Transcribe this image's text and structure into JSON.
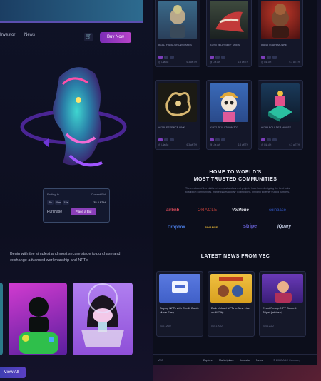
{
  "nav": {
    "items": [
      "Investor",
      "News"
    ],
    "buy_label": "Buy Now"
  },
  "hero": {
    "bid_label_left": "Ending In",
    "bid_label_right": "Current Bid",
    "times": [
      "3h",
      "20m",
      "15s"
    ],
    "price": "35.4 ETH",
    "purchase_label": "Purchase",
    "bid_button": "Place a Bid"
  },
  "tagline": "Begin with the simplest and most secure stage to purchase and exchange advanced workmanship and NFT's",
  "view_all": "View All",
  "nft_cards": [
    {
      "name": "#1347 HAND-GROWN APES",
      "tag": "#1347"
    },
    {
      "name": "#1290 JELLYBEEF DOEA",
      "tag": "#1290"
    },
    {
      "name": "#3845 (B)APEMONKE",
      "tag": "#3845"
    },
    {
      "name": "#1289 ESSENCE LINK",
      "tag": "#1289"
    },
    {
      "name": "#1932 SKULLTOON 3D3",
      "tag": "#1932"
    },
    {
      "name": "#1299 BOULDER HOUSE",
      "tag": "#1299"
    }
  ],
  "card_owner": "@ Lila Art",
  "card_price": "6.3 wETH",
  "communities": {
    "title_1": "HOME TO WORLD'S",
    "title_2": "MOST TRUSTED COMMUNITIES",
    "blurb": "The creators of this platform from past and current projects have been designing the best tools to support communities, marketplaces and NFT campaigns, bringing together trusted partners.",
    "logos": [
      {
        "name": "airbnb",
        "color": "#d64a5a"
      },
      {
        "name": "ORACLE",
        "color": "#c8413b"
      },
      {
        "name": "Verifone",
        "color": "#e8e8f0"
      },
      {
        "name": "coinbase",
        "color": "#3459c9"
      },
      {
        "name": "Dropbox",
        "color": "#4a7be0"
      },
      {
        "name": "BINANCE",
        "color": "#e0b135"
      },
      {
        "name": "stripe",
        "color": "#6a63d9"
      },
      {
        "name": "jQuery",
        "color": "#c9d2ea"
      }
    ]
  },
  "news_title": "LATEST NEWS FROM VEC",
  "news": [
    {
      "title": "Buying NFTs with Credit Cards Made Easy",
      "date": "03.01.2022"
    },
    {
      "title": "Bulk Upload NFTs to New Live on NFTify",
      "date": "03.01.2022"
    },
    {
      "title": "Event Recap: NFT Summit Taipei (Intrinsic)",
      "date": "03.01.2022"
    }
  ],
  "footer": {
    "brand": "VEC",
    "links": [
      "Explore",
      "Marketplace",
      "Investor",
      "News"
    ],
    "copyright": "© 2022 ABC Company"
  }
}
